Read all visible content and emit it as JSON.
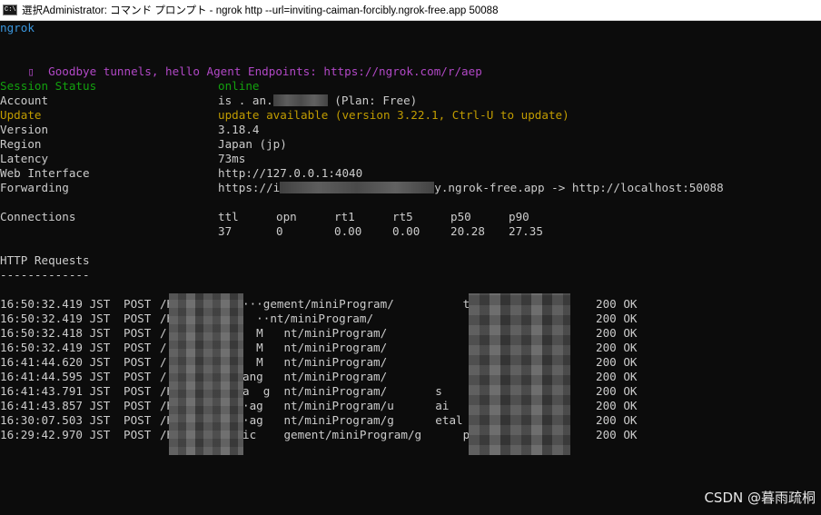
{
  "window": {
    "icon_label": "C:\\",
    "title": "選択Administrator: コマンド プロンプト - ngrok  http --url=inviting-caiman-forcibly.ngrok-free.app 50088"
  },
  "terminal": {
    "app_name": "ngrok",
    "banner_glyph": "▯",
    "banner": "Goodbye tunnels, hello Agent Endpoints: https://ngrok.com/r/aep",
    "colors": {
      "background": "#0c0c0c",
      "text": "#cccccc",
      "banner": "#b148c6",
      "online": "#13a10e",
      "update": "#c19c00",
      "app_name": "#3a96dd"
    },
    "status": {
      "session_label": "Session Status",
      "session_value": "online",
      "account_label": "Account",
      "account_value_start": "is",
      "account_value_mid": " . an.",
      "account_plan": " (Plan: Free)",
      "update_label": "Update",
      "update_value": "update available (version 3.22.1, Ctrl-U to update)",
      "version_label": "Version",
      "version_value": "3.18.4",
      "region_label": "Region",
      "region_value": "Japan (jp)",
      "latency_label": "Latency",
      "latency_value": "73ms",
      "web_label": "Web Interface",
      "web_value": "http://127.0.0.1:4040",
      "forwarding_label": "Forwarding",
      "forwarding_start": "https://i",
      "forwarding_end": "y.ngrok-free.app -> http://localhost:50088"
    },
    "connections": {
      "label": "Connections",
      "headers": [
        "ttl",
        "opn",
        "rt1",
        "rt5",
        "p50",
        "p90"
      ],
      "values": [
        "37",
        "0",
        "0.00",
        "0.00",
        "20.28",
        "27.35"
      ]
    },
    "http": {
      "title": "HTTP Requests",
      "rule": "-------------",
      "requests": [
        {
          "time": "16:50:32.419 JST",
          "method": "POST",
          "path": "/H          ···gement/miniProgram/          t",
          "status": "200 OK"
        },
        {
          "time": "16:50:32.419 JST",
          "method": "POST",
          "path": "/H     rva    ··nt/miniProgram/",
          "status": "200 OK"
        },
        {
          "time": "16:50:32.418 JST",
          "method": "POST",
          "path": "/      rva    M   nt/miniProgram/",
          "status": "200 OK"
        },
        {
          "time": "16:50:32.419 JST",
          "method": "POST",
          "path": "/      rva    M   nt/miniProgram/",
          "status": "200 OK"
        },
        {
          "time": "16:41:44.620 JST",
          "method": "POST",
          "path": "/      rva    M   nt/miniProgram/",
          "status": "200 OK"
        },
        {
          "time": "16:41:44.595 JST",
          "method": "POST",
          "path": "/          ·ang   nt/miniProgram/",
          "status": "200 OK"
        },
        {
          "time": "16:41:43.791 JST",
          "method": "POST",
          "path": "/H          a  g  nt/miniProgram/       s",
          "status": "200 OK"
        },
        {
          "time": "16:41:43.857 JST",
          "method": "POST",
          "path": "/H          ·ag   nt/miniProgram/u      ai",
          "status": "200 OK"
        },
        {
          "time": "16:30:07.503 JST",
          "method": "POST",
          "path": "/H          ·ag   nt/miniProgram/g      etal",
          "status": "200 OK"
        },
        {
          "time": "16:29:42.970 JST",
          "method": "POST",
          "path": "/H kyu    atic    gement/miniProgram/g      pe",
          "status": "200 OK"
        }
      ]
    }
  },
  "watermark": "CSDN @暮雨疏桐"
}
